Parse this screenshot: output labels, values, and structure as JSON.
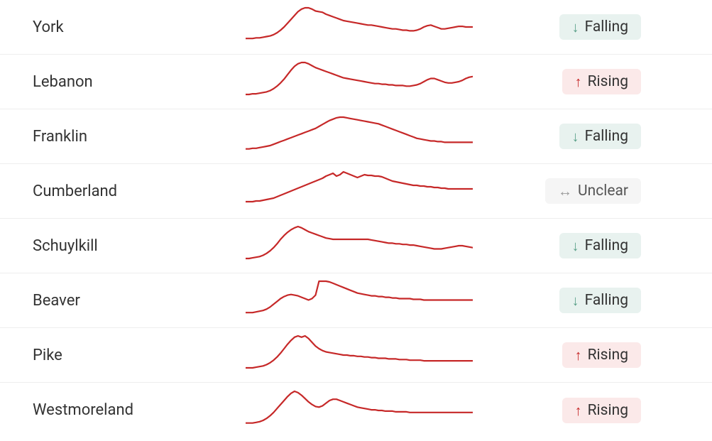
{
  "status_labels": {
    "falling": "Falling",
    "rising": "Rising",
    "unclear": "Unclear"
  },
  "rows": [
    {
      "name": "York",
      "status": "falling"
    },
    {
      "name": "Lebanon",
      "status": "rising"
    },
    {
      "name": "Franklin",
      "status": "falling"
    },
    {
      "name": "Cumberland",
      "status": "unclear"
    },
    {
      "name": "Schuylkill",
      "status": "falling"
    },
    {
      "name": "Beaver",
      "status": "falling"
    },
    {
      "name": "Pike",
      "status": "rising"
    },
    {
      "name": "Westmoreland",
      "status": "rising"
    }
  ],
  "chart_data": [
    {
      "type": "line",
      "series_name": "York",
      "title": "",
      "xlabel": "",
      "ylabel": "",
      "values": [
        12,
        12,
        12,
        13,
        13,
        14,
        15,
        16,
        18,
        21,
        25,
        30,
        36,
        42,
        48,
        54,
        58,
        60,
        60,
        58,
        55,
        54,
        53,
        50,
        48,
        46,
        44,
        42,
        40,
        39,
        38,
        37,
        36,
        35,
        34,
        33,
        33,
        32,
        31,
        30,
        29,
        28,
        27,
        27,
        26,
        25,
        25,
        24,
        24,
        25,
        27,
        30,
        32,
        33,
        31,
        29,
        27,
        27,
        28,
        29,
        30,
        31,
        31,
        30,
        30,
        30
      ]
    },
    {
      "type": "line",
      "series_name": "Lebanon",
      "title": "",
      "xlabel": "",
      "ylabel": "",
      "values": [
        10,
        10,
        11,
        11,
        12,
        13,
        14,
        16,
        19,
        23,
        28,
        34,
        41,
        48,
        54,
        58,
        60,
        60,
        58,
        55,
        52,
        50,
        48,
        46,
        44,
        42,
        40,
        38,
        36,
        35,
        34,
        33,
        32,
        31,
        30,
        29,
        28,
        27,
        27,
        26,
        26,
        25,
        25,
        24,
        24,
        24,
        23,
        23,
        24,
        25,
        27,
        30,
        33,
        35,
        35,
        33,
        31,
        29,
        28,
        28,
        29,
        30,
        32,
        35,
        37,
        38
      ]
    },
    {
      "type": "line",
      "series_name": "Franklin",
      "title": "",
      "xlabel": "",
      "ylabel": "",
      "values": [
        10,
        10,
        11,
        11,
        12,
        13,
        14,
        15,
        17,
        19,
        21,
        23,
        25,
        27,
        29,
        31,
        33,
        35,
        37,
        39,
        41,
        44,
        47,
        50,
        53,
        55,
        57,
        58,
        58,
        57,
        56,
        55,
        54,
        53,
        52,
        51,
        50,
        49,
        48,
        46,
        44,
        42,
        40,
        38,
        36,
        34,
        32,
        30,
        28,
        26,
        25,
        24,
        23,
        22,
        22,
        21,
        21,
        20,
        20,
        20,
        20,
        20,
        20,
        20,
        20,
        20
      ]
    },
    {
      "type": "line",
      "series_name": "Cumberland",
      "title": "",
      "xlabel": "",
      "ylabel": "",
      "values": [
        12,
        12,
        12,
        13,
        13,
        14,
        15,
        16,
        17,
        19,
        21,
        23,
        25,
        27,
        29,
        31,
        33,
        35,
        37,
        39,
        41,
        43,
        45,
        48,
        50,
        52,
        48,
        50,
        54,
        52,
        50,
        48,
        46,
        48,
        50,
        49,
        49,
        48,
        48,
        47,
        45,
        43,
        41,
        40,
        39,
        38,
        37,
        36,
        35,
        35,
        34,
        34,
        33,
        33,
        32,
        32,
        31,
        31,
        30,
        30,
        30,
        30,
        30,
        30,
        30,
        30
      ]
    },
    {
      "type": "line",
      "series_name": "Schuylkill",
      "title": "",
      "xlabel": "",
      "ylabel": "",
      "values": [
        10,
        10,
        11,
        12,
        13,
        15,
        18,
        22,
        27,
        33,
        40,
        46,
        51,
        55,
        58,
        60,
        58,
        55,
        52,
        50,
        48,
        46,
        44,
        42,
        41,
        40,
        40,
        40,
        40,
        40,
        40,
        40,
        40,
        40,
        40,
        40,
        39,
        38,
        37,
        36,
        35,
        34,
        34,
        33,
        33,
        32,
        32,
        31,
        31,
        30,
        29,
        28,
        27,
        26,
        25,
        25,
        25,
        26,
        27,
        28,
        29,
        30,
        30,
        29,
        28,
        27
      ]
    },
    {
      "type": "line",
      "series_name": "Beaver",
      "title": "",
      "xlabel": "",
      "ylabel": "",
      "values": [
        10,
        10,
        10,
        11,
        12,
        13,
        15,
        18,
        22,
        26,
        30,
        33,
        35,
        36,
        35,
        34,
        32,
        30,
        28,
        30,
        35,
        55,
        55,
        55,
        54,
        52,
        50,
        48,
        46,
        44,
        42,
        40,
        38,
        37,
        36,
        35,
        34,
        34,
        33,
        33,
        32,
        32,
        31,
        31,
        30,
        30,
        30,
        30,
        29,
        29,
        29,
        28,
        28,
        28,
        28,
        28,
        28,
        28,
        28,
        28,
        28,
        28,
        28,
        28,
        28,
        28
      ]
    },
    {
      "type": "line",
      "series_name": "Pike",
      "title": "",
      "xlabel": "",
      "ylabel": "",
      "values": [
        10,
        10,
        10,
        11,
        12,
        13,
        15,
        18,
        22,
        27,
        33,
        40,
        47,
        53,
        58,
        60,
        58,
        60,
        56,
        50,
        44,
        40,
        37,
        35,
        34,
        33,
        32,
        31,
        30,
        30,
        29,
        29,
        28,
        28,
        27,
        27,
        26,
        26,
        25,
        25,
        25,
        24,
        24,
        24,
        23,
        23,
        23,
        22,
        22,
        22,
        22,
        21,
        21,
        21,
        21,
        21,
        21,
        21,
        21,
        21,
        21,
        21,
        21,
        21,
        21,
        21
      ]
    },
    {
      "type": "line",
      "series_name": "Westmoreland",
      "title": "",
      "xlabel": "",
      "ylabel": "",
      "values": [
        10,
        10,
        10,
        11,
        12,
        14,
        17,
        21,
        26,
        32,
        38,
        44,
        50,
        55,
        58,
        56,
        52,
        47,
        42,
        38,
        35,
        34,
        36,
        40,
        44,
        46,
        46,
        44,
        42,
        40,
        38,
        36,
        34,
        33,
        32,
        31,
        30,
        30,
        29,
        29,
        28,
        28,
        28,
        27,
        27,
        27,
        27,
        26,
        26,
        26,
        26,
        26,
        26,
        26,
        26,
        26,
        26,
        26,
        26,
        26,
        26,
        26,
        26,
        26,
        26,
        26
      ]
    }
  ]
}
